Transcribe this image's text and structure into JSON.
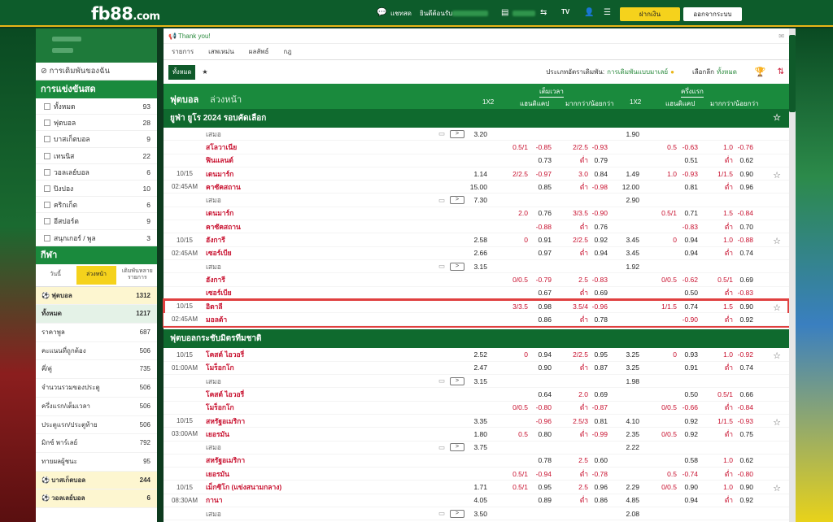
{
  "topbar": {
    "logo_main": "fb88",
    "logo_suffix": ".com",
    "chat": "แชทสด",
    "welcome": "ยินดีต้อนรับ",
    "deposit": "ฝากเงิน",
    "logout": "ออกจากระบบ"
  },
  "sidebar": {
    "my_bets": "การเดิมพันของฉัน",
    "live_title": "การแข่งขันสด",
    "live_items": [
      [
        "ทั้งหมด",
        "93"
      ],
      [
        "ฟุตบอล",
        "28"
      ],
      [
        "บาสเก็ตบอล",
        "9"
      ],
      [
        "เทนนิส",
        "22"
      ],
      [
        "วอลเลย์บอล",
        "6"
      ],
      [
        "ปิงปอง",
        "10"
      ],
      [
        "คริกเก็ต",
        "6"
      ],
      [
        "อีสปอร์ต",
        "9"
      ],
      [
        "สนุกเกอร์ / พูล",
        "3"
      ]
    ],
    "sport_title": "กีฬา",
    "tabs": [
      "วันนี้",
      "ล่วงหน้า",
      "เดิมพันหลายรายการ"
    ],
    "sport_items": [
      [
        "ฟุตบอล",
        "1312"
      ],
      [
        "ทั้งหมด",
        "1217"
      ],
      [
        "ราคาพูล",
        "687"
      ],
      [
        "คะแนนที่ถูกต้อง",
        "506"
      ],
      [
        "คี่/คู่",
        "735"
      ],
      [
        "จำนวนรวมของประตู",
        "506"
      ],
      [
        "ครึ่งแรก/เต็มเวลา",
        "506"
      ],
      [
        "ประตูแรก/ประตูท้าย",
        "506"
      ],
      [
        "มิกซ์ พาร์เลย์",
        "792"
      ],
      [
        "ทายผลผู้ชนะ",
        "95"
      ],
      [
        "บาสเก็ตบอล",
        "244"
      ],
      [
        "วอลเลย์บอล",
        "6"
      ]
    ]
  },
  "main": {
    "notice": "Thank you!",
    "tabs": [
      "รายการ",
      "เสพเหม่น",
      "ผลลัพธ์",
      "กฎ"
    ],
    "filter_all": "ทั้งหมด",
    "bettype_label": "ประเภทอัตราเดิมพัน:",
    "bettype_value": "การเดิมพันแบบมาเลย์",
    "choose_label": "เลือกลีก",
    "choose_value": "ทั้งหมด",
    "section_title": "ฟุตบอล",
    "section_sub": "ล่วงหน้า",
    "ft_label": "เต็มเวลา",
    "ht_label": "ครึ่งแรก",
    "col_1x2": "1X2",
    "col_hdp": "แฮนดิแคป",
    "col_ou": "มากกว่า/น้อยกว่า",
    "league1": "ยูฟ่า ยูโร 2024 รอบคัดเลือก",
    "league2": "ฟุตบอลกระชับมิตรทีมชาติ"
  },
  "rows1": [
    [
      "",
      "เสมอ",
      "d",
      "3.20",
      "",
      "",
      "",
      "",
      "1.90",
      "",
      "",
      "",
      ""
    ],
    [
      "",
      "สโลวาเนีย",
      "t",
      "",
      "0.5/1",
      "-0.85",
      "2/2.5",
      "-0.93",
      "",
      "0.5",
      "-0.63",
      "1.0",
      "-0.76"
    ],
    [
      "",
      "ฟินแลนด์",
      "t",
      "",
      "",
      "0.73",
      "ต่ำ",
      "0.79",
      "",
      "",
      "0.51",
      "ต่ำ",
      "0.62"
    ],
    [
      "10/15",
      "เดนมาร์ก",
      "t",
      "1.14",
      "2/2.5",
      "-0.97",
      "3.0",
      "0.84",
      "1.49",
      "1.0",
      "-0.93",
      "1/1.5",
      "0.90"
    ],
    [
      "02:45AM",
      "คาซัคสถาน",
      "t",
      "15.00",
      "",
      "0.85",
      "ต่ำ",
      "-0.98",
      "12.00",
      "",
      "0.81",
      "ต่ำ",
      "0.96"
    ],
    [
      "",
      "เสมอ",
      "d",
      "7.30",
      "",
      "",
      "",
      "",
      "2.90",
      "",
      "",
      "",
      ""
    ],
    [
      "",
      "เดนมาร์ก",
      "t",
      "",
      "2.0",
      "0.76",
      "3/3.5",
      "-0.90",
      "",
      "0.5/1",
      "0.71",
      "1.5",
      "-0.84"
    ],
    [
      "",
      "คาซัคสถาน",
      "t",
      "",
      "",
      "-0.88",
      "ต่ำ",
      "0.76",
      "",
      "",
      "-0.83",
      "ต่ำ",
      "0.70"
    ],
    [
      "10/15",
      "ฮังการี",
      "t",
      "2.58",
      "0",
      "0.91",
      "2/2.5",
      "0.92",
      "3.45",
      "0",
      "0.94",
      "1.0",
      "-0.88"
    ],
    [
      "02:45AM",
      "เซอร์เบีย",
      "t",
      "2.66",
      "",
      "0.97",
      "ต่ำ",
      "0.94",
      "3.45",
      "",
      "0.94",
      "ต่ำ",
      "0.74"
    ],
    [
      "",
      "เสมอ",
      "d",
      "3.15",
      "",
      "",
      "",
      "",
      "1.92",
      "",
      "",
      "",
      ""
    ],
    [
      "",
      "ฮังการี",
      "t",
      "",
      "0/0.5",
      "-0.79",
      "2.5",
      "-0.83",
      "",
      "0/0.5",
      "-0.62",
      "0.5/1",
      "0.69"
    ],
    [
      "",
      "เซอร์เบีย",
      "t",
      "",
      "",
      "0.67",
      "ต่ำ",
      "0.69",
      "",
      "",
      "0.50",
      "ต่ำ",
      "-0.83"
    ],
    [
      "10/15",
      "อิตาลี",
      "t",
      "",
      "3/3.5",
      "0.98",
      "3.5/4",
      "-0.96",
      "",
      "1/1.5",
      "0.74",
      "1.5",
      "0.90"
    ],
    [
      "02:45AM",
      "มอลต้า",
      "t",
      "",
      "",
      "0.86",
      "ต่ำ",
      "0.78",
      "",
      "",
      "-0.90",
      "ต่ำ",
      "0.92"
    ]
  ],
  "rows2": [
    [
      "10/15",
      "โคสต์ ไอวอรี่",
      "t",
      "2.52",
      "0",
      "0.94",
      "2/2.5",
      "0.95",
      "3.25",
      "0",
      "0.93",
      "1.0",
      "-0.92"
    ],
    [
      "01:00AM",
      "โมร็อกโก",
      "t",
      "2.47",
      "",
      "0.90",
      "ต่ำ",
      "0.87",
      "3.25",
      "",
      "0.91",
      "ต่ำ",
      "0.74"
    ],
    [
      "",
      "เสมอ",
      "d",
      "3.15",
      "",
      "",
      "",
      "",
      "1.98",
      "",
      "",
      "",
      ""
    ],
    [
      "",
      "โคสต์ ไอวอรี่",
      "t",
      "",
      "",
      "0.64",
      "2.0",
      "0.69",
      "",
      "",
      "0.50",
      "0.5/1",
      "0.66"
    ],
    [
      "",
      "โมร็อกโก",
      "t",
      "",
      "0/0.5",
      "-0.80",
      "ต่ำ",
      "-0.87",
      "",
      "0/0.5",
      "-0.66",
      "ต่ำ",
      "-0.84"
    ],
    [
      "10/15",
      "สหรัฐอเมริกา",
      "t",
      "3.35",
      "",
      "-0.96",
      "2.5/3",
      "0.81",
      "4.10",
      "",
      "0.92",
      "1/1.5",
      "-0.93"
    ],
    [
      "03:00AM",
      "เยอรมัน",
      "t",
      "1.80",
      "0.5",
      "0.80",
      "ต่ำ",
      "-0.99",
      "2.35",
      "0/0.5",
      "0.92",
      "ต่ำ",
      "0.75"
    ],
    [
      "",
      "เสมอ",
      "d",
      "3.75",
      "",
      "",
      "",
      "",
      "2.22",
      "",
      "",
      "",
      ""
    ],
    [
      "",
      "สหรัฐอเมริกา",
      "t",
      "",
      "",
      "0.78",
      "2.5",
      "0.60",
      "",
      "",
      "0.58",
      "1.0",
      "0.62"
    ],
    [
      "",
      "เยอรมัน",
      "t",
      "",
      "0.5/1",
      "-0.94",
      "ต่ำ",
      "-0.78",
      "",
      "0.5",
      "-0.74",
      "ต่ำ",
      "-0.80"
    ],
    [
      "10/15",
      "เม็กซิโก (แข่งสนามกลาง)",
      "t",
      "1.71",
      "0.5/1",
      "0.95",
      "2.5",
      "0.96",
      "2.29",
      "0/0.5",
      "0.90",
      "1.0",
      "0.90"
    ],
    [
      "08:30AM",
      "กานา",
      "t",
      "4.05",
      "",
      "0.89",
      "ต่ำ",
      "0.86",
      "4.85",
      "",
      "0.94",
      "ต่ำ",
      "0.92"
    ],
    [
      "",
      "เสมอ",
      "d",
      "3.50",
      "",
      "",
      "",
      "",
      "2.08",
      "",
      "",
      "",
      ""
    ]
  ]
}
